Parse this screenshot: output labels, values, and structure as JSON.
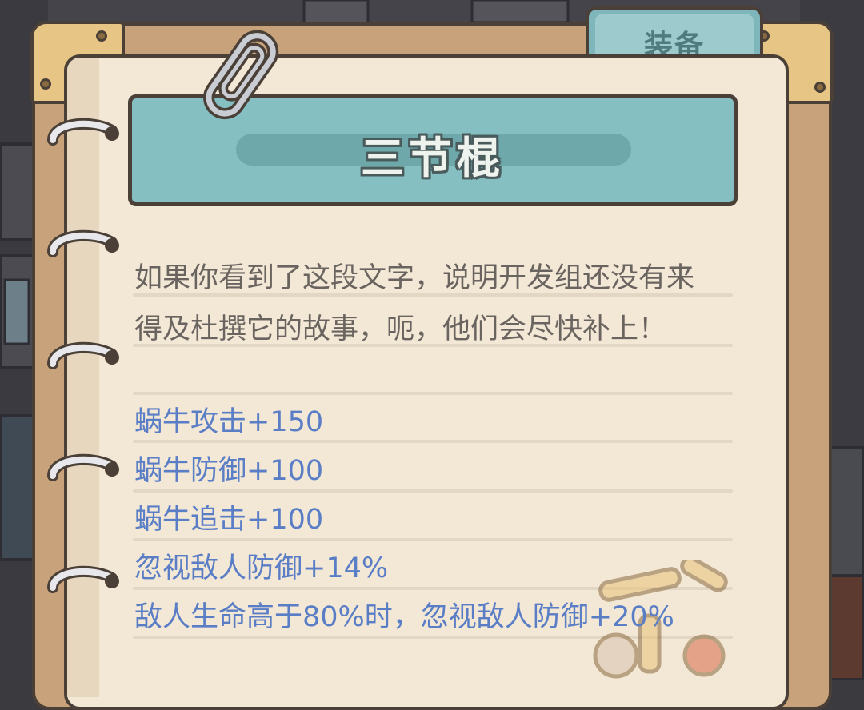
{
  "tab": {
    "label": "装备"
  },
  "item": {
    "name": "三节棍",
    "description_lines": [
      "如果你看到了这段文字，说明开发组还没有来",
      "得及杜撰它的故事，呃，他们会尽快补上！"
    ],
    "stats": [
      "蜗牛攻击+150",
      "蜗牛防御+100",
      "蜗牛追击+100",
      "忽视敌人防御+14%",
      "敌人生命高于80%时，忽视敌人防御+20%"
    ]
  },
  "icons": {
    "paperclip": "paperclip-icon",
    "binder_ring": "binder-ring-icon",
    "weapon": "nunchaku-weapon-icon"
  },
  "colors": {
    "paper": "#f3e7d5",
    "banner": "#86bfc2",
    "stat_text": "#5a7ec6",
    "desc_text": "#6a6460",
    "outline": "#4a4038"
  }
}
